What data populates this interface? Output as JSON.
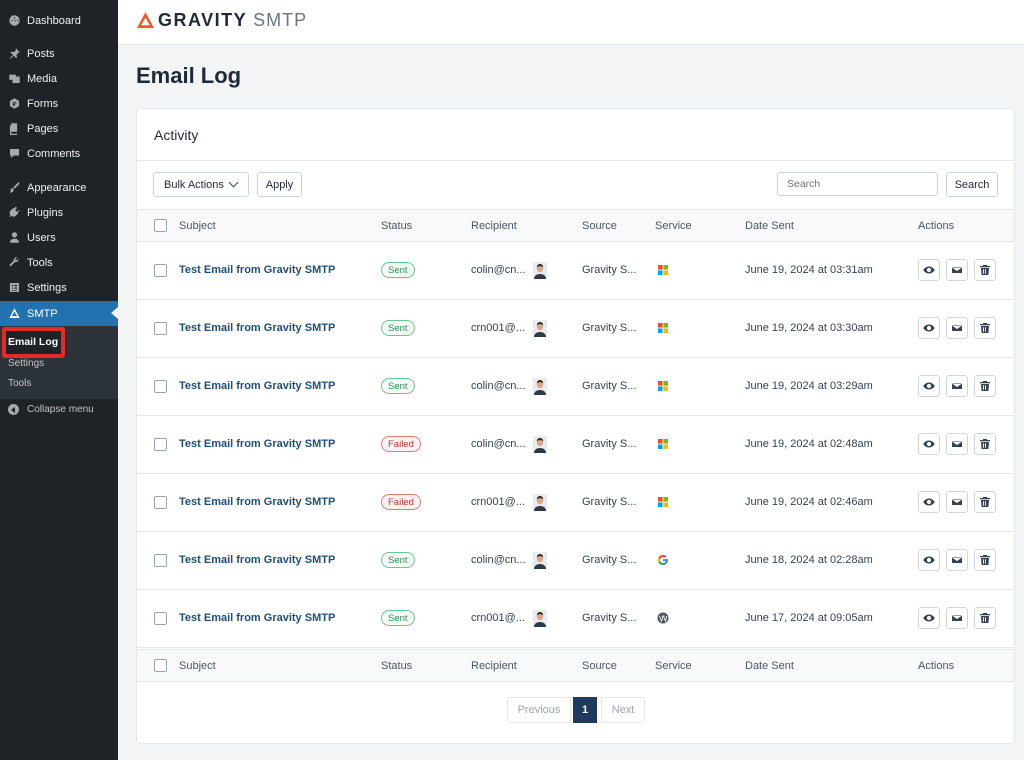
{
  "sidebar": {
    "items": [
      {
        "label": "Dashboard",
        "icon": "dashboard-icon"
      },
      {
        "label": "Posts",
        "icon": "pin-icon"
      },
      {
        "label": "Media",
        "icon": "media-icon"
      },
      {
        "label": "Forms",
        "icon": "forms-icon"
      },
      {
        "label": "Pages",
        "icon": "pages-icon"
      },
      {
        "label": "Comments",
        "icon": "comment-icon"
      },
      {
        "label": "Appearance",
        "icon": "brush-icon"
      },
      {
        "label": "Plugins",
        "icon": "plug-icon"
      },
      {
        "label": "Users",
        "icon": "user-icon"
      },
      {
        "label": "Tools",
        "icon": "wrench-icon"
      },
      {
        "label": "Settings",
        "icon": "settings-icon"
      },
      {
        "label": "SMTP",
        "icon": "gravity-icon"
      }
    ],
    "submenu": {
      "email_log": "Email Log",
      "settings": "Settings",
      "tools": "Tools"
    },
    "collapse": "Collapse menu"
  },
  "header": {
    "brand": "GRAVITY",
    "brand_suffix": "SMTP",
    "accent": "#f15a24"
  },
  "page_title": "Email Log",
  "card": {
    "title": "Activity",
    "bulk_actions": "Bulk Actions",
    "apply": "Apply",
    "search_placeholder": "Search",
    "search_button": "Search"
  },
  "table": {
    "columns": [
      "Subject",
      "Status",
      "Recipient",
      "Source",
      "Service",
      "Date Sent",
      "Actions"
    ],
    "rows": [
      {
        "subject": "Test Email from Gravity SMTP",
        "status": "Sent",
        "recipient": "colin@cn...",
        "source": "Gravity S...",
        "service": "microsoft",
        "date": "June 19, 2024 at 03:31am"
      },
      {
        "subject": "Test Email from Gravity SMTP",
        "status": "Sent",
        "recipient": "crn001@...",
        "source": "Gravity S...",
        "service": "microsoft",
        "date": "June 19, 2024 at 03:30am"
      },
      {
        "subject": "Test Email from Gravity SMTP",
        "status": "Sent",
        "recipient": "colin@cn...",
        "source": "Gravity S...",
        "service": "microsoft",
        "date": "June 19, 2024 at 03:29am"
      },
      {
        "subject": "Test Email from Gravity SMTP",
        "status": "Failed",
        "recipient": "colin@cn...",
        "source": "Gravity S...",
        "service": "microsoft",
        "date": "June 19, 2024 at 02:48am"
      },
      {
        "subject": "Test Email from Gravity SMTP",
        "status": "Failed",
        "recipient": "crn001@...",
        "source": "Gravity S...",
        "service": "microsoft",
        "date": "June 19, 2024 at 02:46am"
      },
      {
        "subject": "Test Email from Gravity SMTP",
        "status": "Sent",
        "recipient": "colin@cn...",
        "source": "Gravity S...",
        "service": "google",
        "date": "June 18, 2024 at 02:28am"
      },
      {
        "subject": "Test Email from Gravity SMTP",
        "status": "Sent",
        "recipient": "crn001@...",
        "source": "Gravity S...",
        "service": "wordpress",
        "date": "June 17, 2024 at 09:05am"
      }
    ]
  },
  "pagination": {
    "previous": "Previous",
    "current": "1",
    "next": "Next"
  }
}
